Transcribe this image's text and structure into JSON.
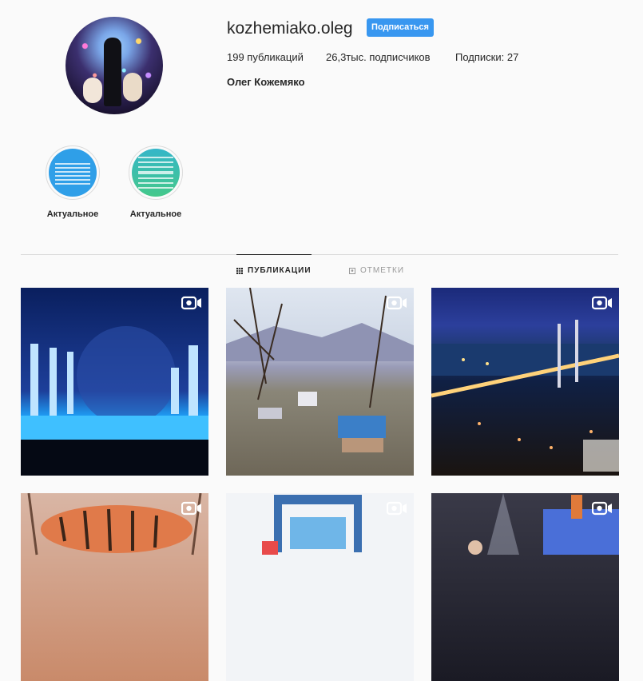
{
  "profile": {
    "username": "kozhemiako.oleg",
    "follow_label": "Подписаться",
    "full_name": "Олег Кожемяко",
    "avatar_icon": "profile-photo"
  },
  "stats": {
    "posts": "199 публикаций",
    "followers": "26,3тыс. подписчиков",
    "following": "Подписки: 27"
  },
  "highlights": [
    {
      "label": "Актуальное",
      "color": "#2f9fe8"
    },
    {
      "label": "Актуальное",
      "color": "#3bbf9a"
    }
  ],
  "tabs": [
    {
      "label": "ПУБЛИКАЦИИ",
      "icon": "grid-icon",
      "active": true
    },
    {
      "label": "ОТМЕТКИ",
      "icon": "tag-icon",
      "active": false
    }
  ],
  "posts": [
    {
      "subject": "theater stage",
      "video": true
    },
    {
      "subject": "town landscape",
      "video": true
    },
    {
      "subject": "night bridge city",
      "video": true
    },
    {
      "subject": "tiger sculpture",
      "video": true
    },
    {
      "subject": "carnival ride",
      "video": true
    },
    {
      "subject": "concert stage",
      "video": true
    }
  ],
  "colors": {
    "accent": "#3897f0",
    "text": "#262626",
    "muted": "#999999",
    "border": "#dbdbdb"
  }
}
